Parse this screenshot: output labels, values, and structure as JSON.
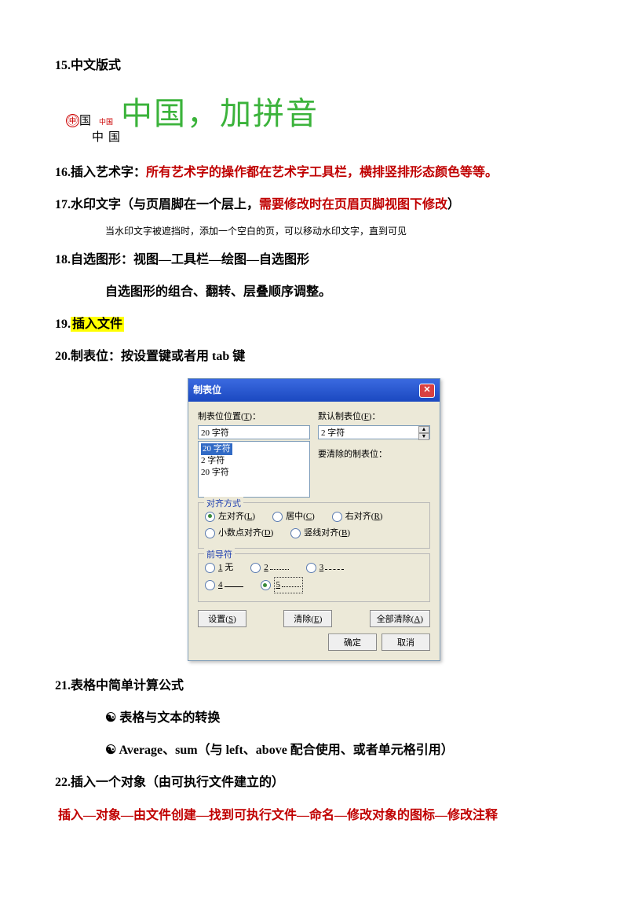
{
  "item15": {
    "num": "15.",
    "text": "中文版式"
  },
  "zhongguo": {
    "combined": "㊥",
    "col1_top": "国",
    "col2_top": "中国",
    "col2_mid1": "中",
    "col2_mid2": "国",
    "big": "中国，加拼音"
  },
  "item16": {
    "num": "16.",
    "label": "插入艺术字：",
    "text": "所有艺术字的操作都在艺术字工具栏，横排竖排形态颜色等等。"
  },
  "item17": {
    "num": "17.",
    "label": "水印文字",
    "paren": "（与页眉脚在一个层上，",
    "red": "需要修改时在页眉页脚视图下修改",
    "close": "）"
  },
  "item17note": "当水印文字被遮挡时，添加一个空白的页，可以移动水印文字，直到可见",
  "item18": {
    "num": "18.",
    "text": "自选图形：视图—工具栏—绘图—自选图形"
  },
  "item18b": "自选图形的组合、翻转、层叠顺序调整。",
  "item19": {
    "num": "19.",
    "text": "插入文件"
  },
  "item20": {
    "num": "20.",
    "text": "制表位：按设置键或者用 tab 键"
  },
  "dialog": {
    "title": "制表位",
    "lbl_pos": "制表位位置(T)：",
    "lbl_default": "默认制表位(F)：",
    "val_pos": "20 字符",
    "val_default": "2 字符",
    "lbl_clear": "要清除的制表位：",
    "list": [
      "20 字符",
      "2 字符",
      "20 字符"
    ],
    "legend_align": "对齐方式",
    "align_left": "左对齐(L)",
    "align_center": "居中(C)",
    "align_right": "右对齐(R)",
    "align_decimal": "小数点对齐(D)",
    "align_bar": "竖线对齐(B)",
    "legend_leader": "前导符",
    "l1": "1 无",
    "l2": "2",
    "l3": "3",
    "l4": "4",
    "l5": "5",
    "btn_set": "设置(S)",
    "btn_clear": "清除(E)",
    "btn_clearall": "全部清除(A)",
    "btn_ok": "确定",
    "btn_cancel": "取消"
  },
  "item21": {
    "num": "21.",
    "text": "表格中简单计算公式"
  },
  "item21a": "表格与文本的转换",
  "item21b": "Average、sum（与 left、above 配合使用、或者单元格引用）",
  "item22": {
    "num": "22.",
    "text": "插入一个对象（由可执行文件建立的）"
  },
  "item22red": "插入—对象—由文件创建—找到可执行文件—命名—修改对象的图标—修改注释",
  "bullet": "☯"
}
